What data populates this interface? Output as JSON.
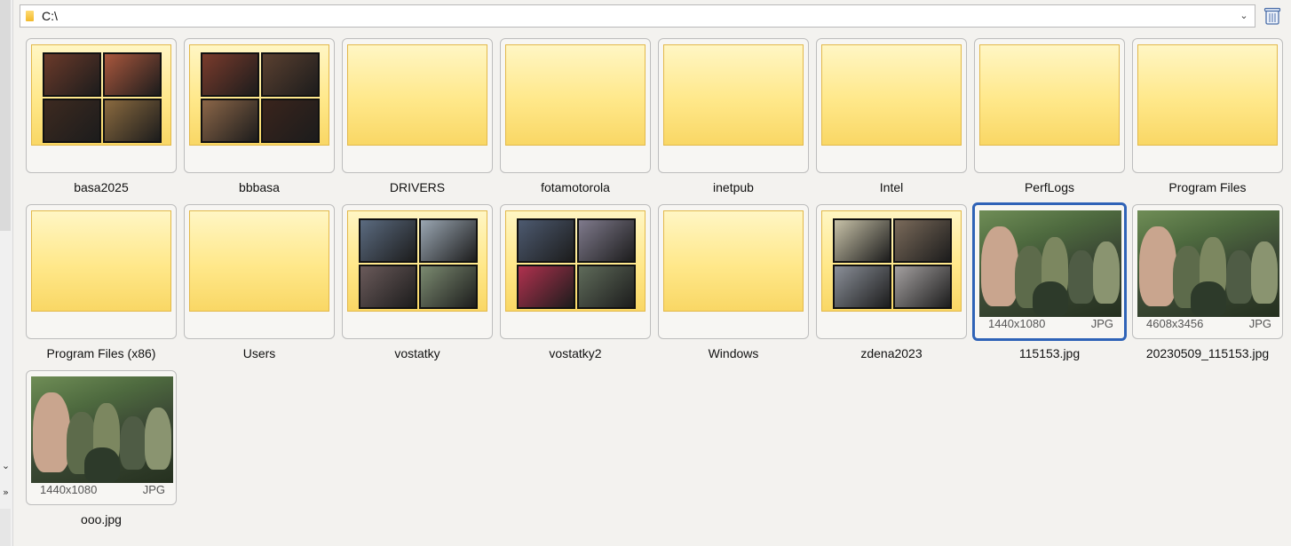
{
  "address": {
    "path": "C:\\"
  },
  "items": [
    {
      "name": "basa2025",
      "type": "folder",
      "thumbs": 4
    },
    {
      "name": "bbbasa",
      "type": "folder",
      "thumbs": 4
    },
    {
      "name": "DRIVERS",
      "type": "folder",
      "thumbs": 0
    },
    {
      "name": "fotamotorola",
      "type": "folder",
      "thumbs": 0
    },
    {
      "name": "inetpub",
      "type": "folder",
      "thumbs": 0
    },
    {
      "name": "Intel",
      "type": "folder",
      "thumbs": 0
    },
    {
      "name": "PerfLogs",
      "type": "folder",
      "thumbs": 0
    },
    {
      "name": "Program Files",
      "type": "folder",
      "thumbs": 0
    },
    {
      "name": "Program Files (x86)",
      "type": "folder",
      "thumbs": 0
    },
    {
      "name": "Users",
      "type": "folder",
      "thumbs": 0
    },
    {
      "name": "vostatky",
      "type": "folder",
      "thumbs": 4
    },
    {
      "name": "vostatky2",
      "type": "folder",
      "thumbs": 4
    },
    {
      "name": "Windows",
      "type": "folder",
      "thumbs": 0
    },
    {
      "name": "zdena2023",
      "type": "folder",
      "thumbs": 4
    },
    {
      "name": "115153.jpg",
      "type": "image",
      "dims": "1440x1080",
      "ext": "JPG",
      "selected": true
    },
    {
      "name": "20230509_115153.jpg",
      "type": "image",
      "dims": "4608x3456",
      "ext": "JPG"
    },
    {
      "name": "ooo.jpg",
      "type": "image",
      "dims": "1440x1080",
      "ext": "JPG"
    }
  ],
  "colors": {
    "selection": "#2f63b7",
    "folder": "#ffe88a"
  }
}
